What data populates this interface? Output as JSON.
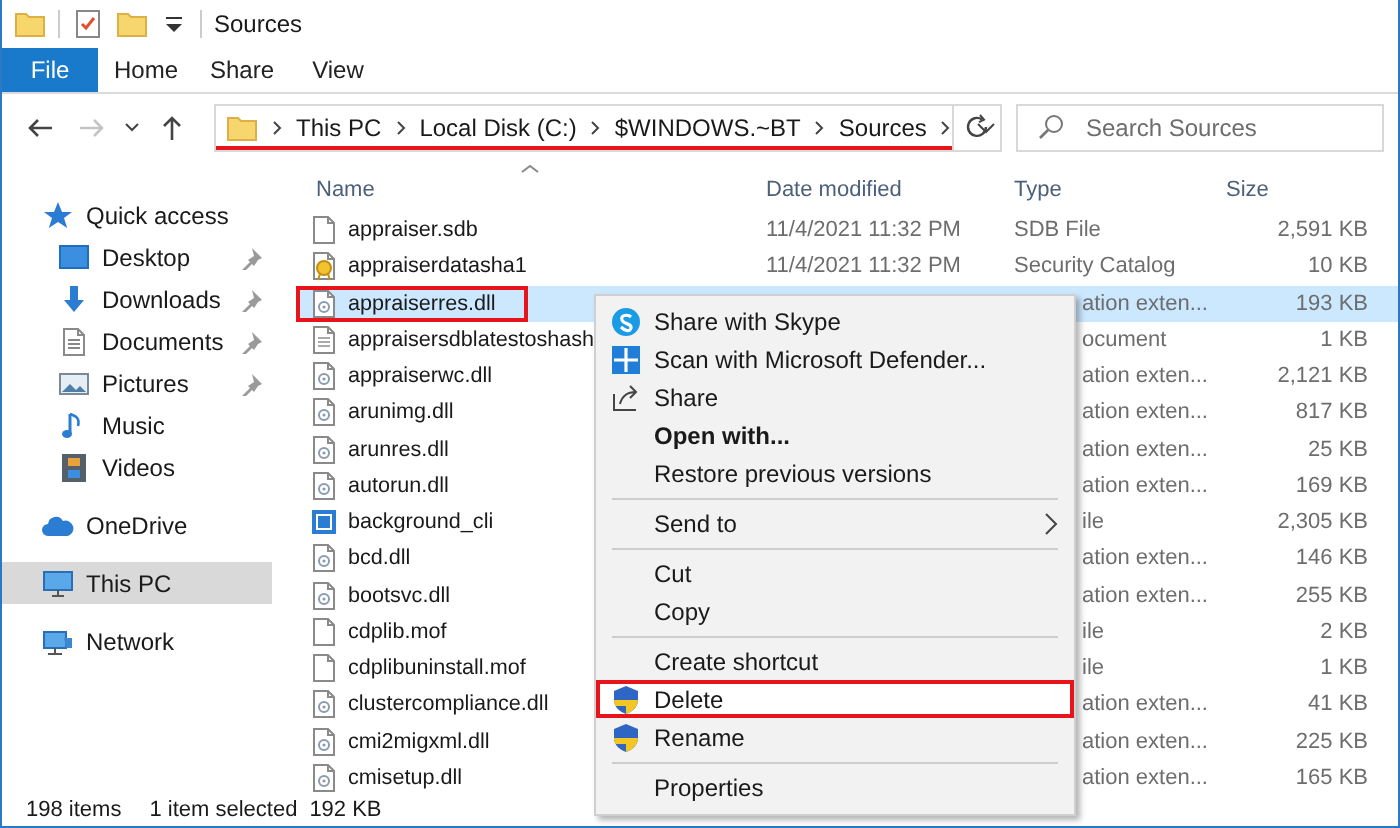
{
  "window": {
    "title": "Sources"
  },
  "ribbon": {
    "tabs": [
      {
        "label": "File",
        "selected": true
      },
      {
        "label": "Home",
        "selected": false
      },
      {
        "label": "Share",
        "selected": false
      },
      {
        "label": "View",
        "selected": false
      }
    ]
  },
  "nav_buttons": [
    {
      "kind": "back",
      "disabled": false
    },
    {
      "kind": "forward",
      "disabled": true
    },
    {
      "kind": "recent",
      "disabled": false
    },
    {
      "kind": "up",
      "disabled": false
    }
  ],
  "address": {
    "highlighted": true,
    "crumbs": [
      "This PC",
      "Local Disk (C:)",
      "$WINDOWS.~BT",
      "Sources"
    ]
  },
  "search": {
    "placeholder": "Search Sources"
  },
  "sidebar": {
    "items": [
      {
        "label": "Quick access",
        "kind": "star",
        "selected": false,
        "children": [
          {
            "label": "Desktop",
            "kind": "desktop",
            "pinned": true,
            "selected": false
          },
          {
            "label": "Downloads",
            "kind": "downloads",
            "pinned": true,
            "selected": false
          },
          {
            "label": "Documents",
            "kind": "documents",
            "pinned": true,
            "selected": false
          },
          {
            "label": "Pictures",
            "kind": "pictures",
            "pinned": true,
            "selected": false
          },
          {
            "label": "Music",
            "kind": "music",
            "pinned": false,
            "selected": false
          },
          {
            "label": "Videos",
            "kind": "videos",
            "pinned": false,
            "selected": false
          }
        ]
      },
      {
        "label": "OneDrive",
        "kind": "cloud",
        "selected": false
      },
      {
        "label": "This PC",
        "kind": "pc",
        "selected": true
      },
      {
        "label": "Network",
        "kind": "network",
        "selected": false
      }
    ]
  },
  "table": {
    "columns": [
      {
        "label": "Name",
        "sorted": true
      },
      {
        "label": "Date modified",
        "sorted": false
      },
      {
        "label": "Type",
        "sorted": false
      },
      {
        "label": "Size",
        "sorted": false
      }
    ],
    "rows": [
      {
        "name": "appraiser.sdb",
        "kind": "blank",
        "date": "11/4/2021 11:32 PM",
        "type": "SDB File",
        "size": "2,591 KB",
        "selected": false,
        "highlighted": false
      },
      {
        "name": "appraiserdatasha1",
        "kind": "catalog",
        "date": "11/4/2021 11:32 PM",
        "type": "Security Catalog",
        "size": "10 KB",
        "selected": false,
        "highlighted": false
      },
      {
        "name": "appraiserres.dll",
        "kind": "dll",
        "type": "ation exten...",
        "size": "193 KB",
        "selected": true,
        "highlighted": true
      },
      {
        "name": "appraisersdblatestoshash",
        "kind": "text",
        "type": "ocument",
        "size": "1 KB",
        "selected": false,
        "highlighted": false
      },
      {
        "name": "appraiserwc.dll",
        "kind": "dll",
        "type": "ation exten...",
        "size": "2,121 KB",
        "selected": false,
        "highlighted": false
      },
      {
        "name": "arunimg.dll",
        "kind": "dll",
        "type": "ation exten...",
        "size": "817 KB",
        "selected": false,
        "highlighted": false
      },
      {
        "name": "arunres.dll",
        "kind": "dll",
        "type": "ation exten...",
        "size": "25 KB",
        "selected": false,
        "highlighted": false
      },
      {
        "name": "autorun.dll",
        "kind": "dll",
        "type": "ation exten...",
        "size": "169 KB",
        "selected": false,
        "highlighted": false
      },
      {
        "name": "background_cli",
        "kind": "image",
        "type": "ile",
        "size": "2,305 KB",
        "selected": false,
        "highlighted": false
      },
      {
        "name": "bcd.dll",
        "kind": "dll",
        "type": "ation exten...",
        "size": "146 KB",
        "selected": false,
        "highlighted": false
      },
      {
        "name": "bootsvc.dll",
        "kind": "dll",
        "type": "ation exten...",
        "size": "255 KB",
        "selected": false,
        "highlighted": false
      },
      {
        "name": "cdplib.mof",
        "kind": "blank",
        "type": "ile",
        "size": "2 KB",
        "selected": false,
        "highlighted": false
      },
      {
        "name": "cdplibuninstall.mof",
        "kind": "blank",
        "type": "ile",
        "size": "1 KB",
        "selected": false,
        "highlighted": false
      },
      {
        "name": "clustercompliance.dll",
        "kind": "dll",
        "type": "ation exten...",
        "size": "41 KB",
        "selected": false,
        "highlighted": false
      },
      {
        "name": "cmi2migxml.dll",
        "kind": "dll",
        "type": "ation exten...",
        "size": "225 KB",
        "selected": false,
        "highlighted": false
      },
      {
        "name": "cmisetup.dll",
        "kind": "dll",
        "type": "ation exten...",
        "size": "165 KB",
        "selected": false,
        "highlighted": false
      }
    ]
  },
  "context_menu": {
    "groups": [
      [
        {
          "label": "Share with Skype",
          "kind": "skype",
          "bold": false,
          "submenu": false,
          "highlighted": false
        },
        {
          "label": "Scan with Microsoft Defender...",
          "kind": "defender",
          "bold": false,
          "submenu": false,
          "highlighted": false
        },
        {
          "label": "Share",
          "kind": "share",
          "bold": false,
          "submenu": false,
          "highlighted": false
        },
        {
          "label": "Open with...",
          "kind": "plain",
          "bold": true,
          "submenu": false,
          "highlighted": false
        },
        {
          "label": "Restore previous versions",
          "kind": "plain",
          "bold": false,
          "submenu": false,
          "highlighted": false
        }
      ],
      [
        {
          "label": "Send to",
          "kind": "plain",
          "bold": false,
          "submenu": true,
          "highlighted": false
        }
      ],
      [
        {
          "label": "Cut",
          "kind": "plain",
          "bold": false,
          "submenu": false,
          "highlighted": false
        },
        {
          "label": "Copy",
          "kind": "plain",
          "bold": false,
          "submenu": false,
          "highlighted": false
        }
      ],
      [
        {
          "label": "Create shortcut",
          "kind": "plain",
          "bold": false,
          "submenu": false,
          "highlighted": false
        },
        {
          "label": "Delete",
          "kind": "shield",
          "bold": false,
          "submenu": false,
          "highlighted": true
        },
        {
          "label": "Rename",
          "kind": "shield",
          "bold": false,
          "submenu": false,
          "highlighted": false
        }
      ],
      [
        {
          "label": "Properties",
          "kind": "plain",
          "bold": false,
          "submenu": false,
          "highlighted": false
        }
      ]
    ]
  },
  "status_bar": {
    "count": "198 items",
    "selection": "1 item selected",
    "size": "192 KB"
  }
}
